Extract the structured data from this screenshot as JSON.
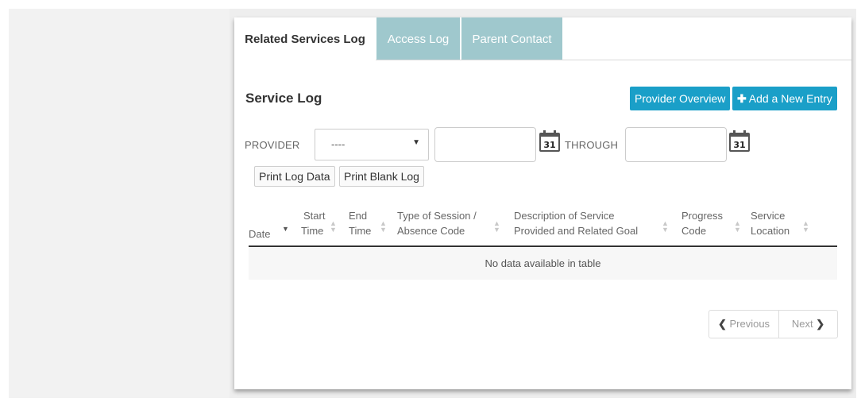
{
  "tabs": [
    {
      "label": "Related Services Log",
      "active": true
    },
    {
      "label": "Access Log",
      "active": false
    },
    {
      "label": "Parent Contact",
      "active": false
    }
  ],
  "section_title": "Service Log",
  "buttons": {
    "provider_overview": "Provider Overview",
    "add_entry": "Add a New Entry",
    "print_log_data": "Print Log Data",
    "print_blank_log": "Print Blank Log"
  },
  "filters": {
    "provider_label": "PROVIDER",
    "provider_value": "----",
    "through_label": "THROUGH",
    "calendar_day": "31"
  },
  "table": {
    "columns": [
      {
        "line1": "Date",
        "line2": ""
      },
      {
        "line1": "Start",
        "line2": "Time"
      },
      {
        "line1": "End",
        "line2": "Time"
      },
      {
        "line1": "Type of Session /",
        "line2": "Absence Code"
      },
      {
        "line1": "Description of Service",
        "line2": "Provided and Related Goal"
      },
      {
        "line1": "Progress",
        "line2": "Code"
      },
      {
        "line1": "Service",
        "line2": "Location"
      }
    ],
    "empty_message": "No data available in table"
  },
  "pagination": {
    "previous": "Previous",
    "next": "Next"
  },
  "colors": {
    "primary_button": "#1a9fc8",
    "inactive_tab": "#9fc8cd"
  }
}
